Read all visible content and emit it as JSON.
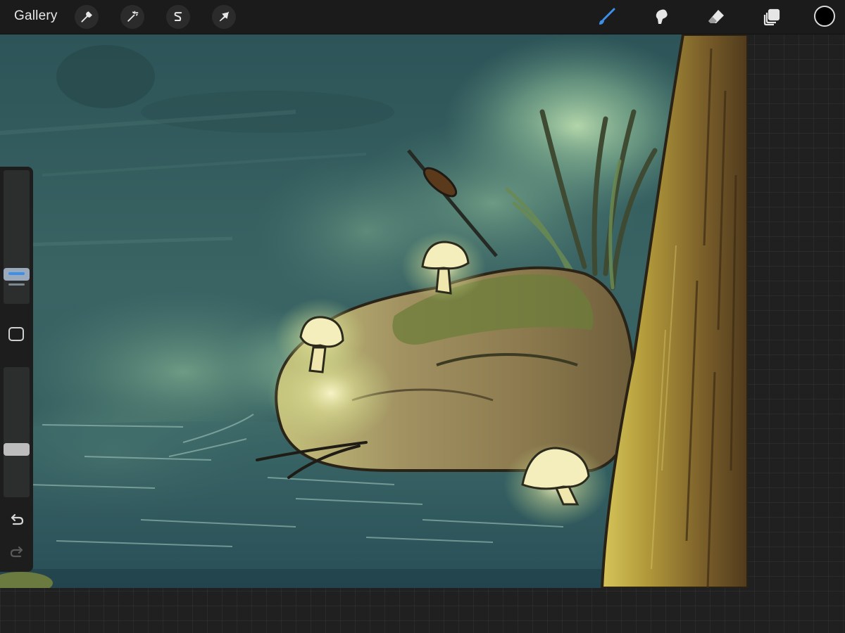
{
  "toolbar": {
    "gallery_label": "Gallery",
    "left_tools": [
      "wrench-icon",
      "magic-wand-icon",
      "selection-s-icon",
      "transform-arrow-icon"
    ],
    "right_tools": [
      "brush-icon",
      "smudge-icon",
      "eraser-icon",
      "layers-icon"
    ],
    "active_tool": "brush-icon",
    "active_color": "#000000",
    "accent_color": "#3d8fe8"
  },
  "sidebar": {
    "brush_size_level": 0.22,
    "opacity_level": 0.7,
    "icons": [
      "modify-square-icon",
      "undo-icon",
      "redo-icon"
    ]
  },
  "canvas": {
    "artwork": "painting"
  }
}
